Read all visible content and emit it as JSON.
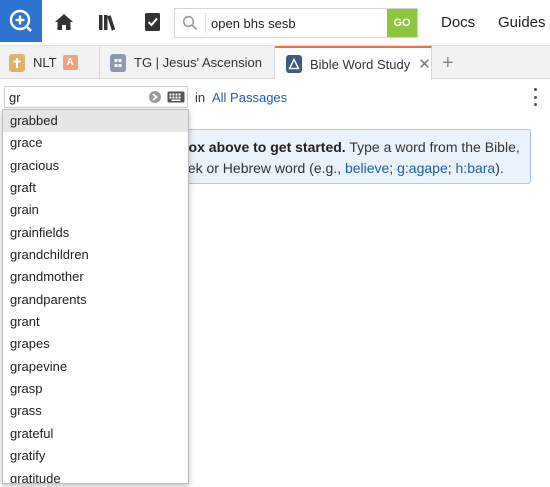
{
  "toolbar": {
    "search_value": "open bhs sesb",
    "go_label": "GO",
    "nav": [
      "Docs",
      "Guides"
    ]
  },
  "tabs": [
    {
      "label": "NLT",
      "badge": "A",
      "icon": "bible-icon",
      "active": false
    },
    {
      "label": "TG | Jesus' Ascension",
      "icon": "topic-guide-icon",
      "active": false
    },
    {
      "label": "Bible Word Study",
      "icon": "word-study-icon",
      "active": true
    }
  ],
  "query": {
    "value": "gr",
    "in_label": "in",
    "scope": "All Passages"
  },
  "info": {
    "bold": "box above to get started.",
    "text1": " Type a word from the Bible,",
    "text2": "eek or Hebrew word (e.g., ",
    "ex1": "believe",
    "sep1": "; ",
    "ex2": "g:agape",
    "sep2": "; ",
    "ex3": "h:bara",
    "end": ")."
  },
  "suggestions": [
    "grabbed",
    "grace",
    "gracious",
    "graft",
    "grain",
    "grainfields",
    "grandchildren",
    "grandmother",
    "grandparents",
    "grant",
    "grapes",
    "grapevine",
    "grasp",
    "grass",
    "grateful",
    "gratify",
    "gratitude"
  ],
  "colors": {
    "brand": "#2d74d0",
    "go": "#8dc63f",
    "active_tab": "#e8734a",
    "link": "#1f5fa8"
  }
}
